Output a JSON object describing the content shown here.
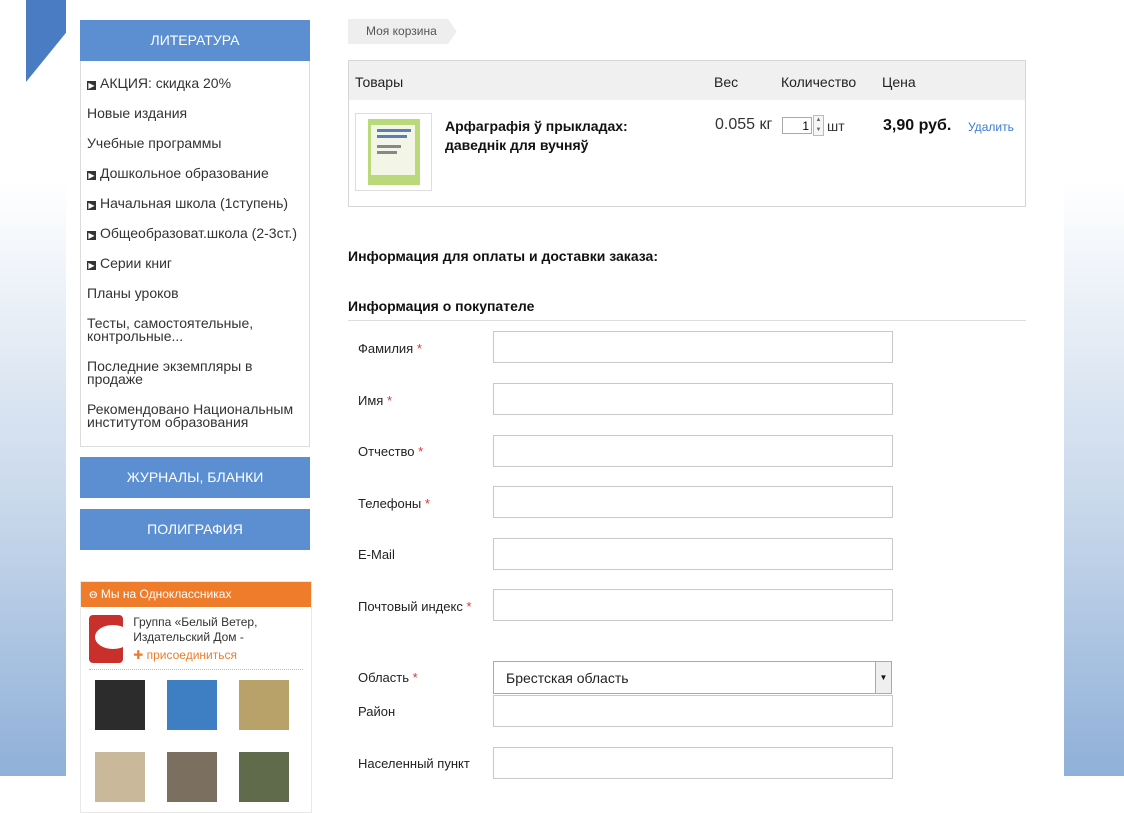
{
  "sidebar": {
    "categories": {
      "literature": "ЛИТЕРАТУРА",
      "journals": "ЖУРНАЛЫ, БЛАНКИ",
      "printing": "ПОЛИГРАФИЯ"
    },
    "menu_items": [
      {
        "label": "АКЦИЯ: скидка 20%",
        "has_arrow": true
      },
      {
        "label": "Новые издания",
        "has_arrow": false
      },
      {
        "label": "Учебные программы",
        "has_arrow": false
      },
      {
        "label": "Дошкольное образование",
        "has_arrow": true
      },
      {
        "label": "Начальная школа (1ступень)",
        "has_arrow": true
      },
      {
        "label": "Общеобразоват.школа (2-3ст.)",
        "has_arrow": true
      },
      {
        "label": "Серии книг",
        "has_arrow": true
      },
      {
        "label": "Планы уроков",
        "has_arrow": false
      },
      {
        "label": "Тесты, самостоятельные, контрольные...",
        "has_arrow": false
      },
      {
        "label": "Последние экземпляры в продаже",
        "has_arrow": false
      },
      {
        "label": "Рекомендовано Национальным институтом образования",
        "has_arrow": false
      }
    ],
    "ok_widget": {
      "title": "Мы на Одноклассниках",
      "group_name": "Группа «Белый Ветер, Издательский Дом -",
      "join_label": "присоединиться",
      "accent_color": "#ee7c2a"
    }
  },
  "breadcrumb": "Моя корзина",
  "cart": {
    "headers": {
      "product": "Товары",
      "weight": "Вес",
      "quantity": "Количество",
      "price": "Цена"
    },
    "item": {
      "title": "Арфаграфія ў прыкладах: даведнік для вучняў",
      "weight": "0.055 кг",
      "quantity": "1",
      "unit": "шт",
      "price": "3,90 руб.",
      "delete_label": "Удалить"
    }
  },
  "payment_title": "Информация для оплаты и доставки заказа:",
  "buyer_title": "Информация о покупателе",
  "form": {
    "last_name": {
      "label": "Фамилия",
      "required": "*",
      "value": ""
    },
    "first_name": {
      "label": "Имя",
      "required": "*",
      "value": ""
    },
    "patronymic": {
      "label": "Отчество",
      "required": "*",
      "value": ""
    },
    "phones": {
      "label": "Телефоны",
      "required": "*",
      "value": ""
    },
    "email": {
      "label": "E-Mail",
      "value": ""
    },
    "postal_code": {
      "label": "Почтовый индекс",
      "required": "*",
      "value": ""
    },
    "region": {
      "label": "Область",
      "required": "*",
      "selected": "Брестская область"
    },
    "district": {
      "label": "Район",
      "value": ""
    },
    "locality": {
      "label": "Населенный пункт",
      "value": ""
    }
  },
  "colors": {
    "brand_blue": "#5b8fd2",
    "required_red": "#d33",
    "link_blue": "#3a7bd5"
  }
}
